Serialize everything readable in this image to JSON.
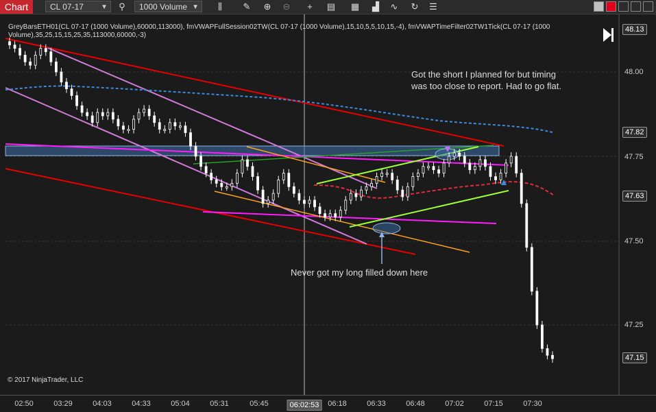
{
  "toolbar": {
    "chart_tab": "Chart",
    "instrument": "CL 07-17",
    "period": "1000 Volume",
    "icons": [
      "search-icon",
      "bar-type-icon",
      "pencil-icon",
      "zoom-in-icon",
      "zoom-out-icon",
      "crosshair-icon",
      "data-box-icon",
      "chart-style-icon",
      "strategy-icon",
      "indicators-icon",
      "drawing-tools-icon",
      "reload-icon",
      "properties-icon"
    ],
    "window_colors": {
      "minimize": "#bfbfbf",
      "close": "#e0001b"
    }
  },
  "indicator_label": "GreyBarsETH01(CL 07-17 (1000 Volume),60000,113000), fmVWAPFullSession02TW(CL 07-17 (1000 Volume),15,10,5,5,10,15,-4), fmVWAPTimeFilter02TW1Tick(CL 07-17 (1000 Volume),35,25,15,15,25,35,113000,60000,-3)",
  "annotations": {
    "top_note_line1": "Got the short I planned for but timing",
    "top_note_line2": "was too close to report. Had to go flat.",
    "bottom_note": "Never got my long filled down here"
  },
  "copyright": "© 2017 NinjaTrader, LLC",
  "x_axis": {
    "ticks": [
      "02:50",
      "03:29",
      "04:03",
      "04:33",
      "05:04",
      "05:31",
      "05:45",
      "06:02:53",
      "06:18",
      "06:33",
      "06:48",
      "07:02",
      "07:15",
      "07:30"
    ],
    "highlight": "06:02:53"
  },
  "y_axis": {
    "ticks": [
      "48.00",
      "47.75",
      "47.50",
      "47.25"
    ],
    "tags": [
      "48.13",
      "47.82",
      "47.63",
      "47.15"
    ]
  },
  "chart_data": {
    "type": "candlestick",
    "instrument": "CL 07-17",
    "ylim": [
      47.08,
      48.17
    ],
    "price_tags": {
      "last": 47.15,
      "vwap_upper": 47.82,
      "vwap_mid": 47.63,
      "top": 48.13
    },
    "close_path": [
      48.08,
      48.07,
      48.05,
      48.03,
      48.02,
      48.05,
      48.07,
      48.06,
      48.03,
      48.0,
      47.97,
      47.95,
      47.93,
      47.9,
      47.88,
      47.87,
      47.85,
      47.88,
      47.87,
      47.88,
      47.86,
      47.84,
      47.83,
      47.83,
      47.86,
      47.88,
      47.89,
      47.87,
      47.85,
      47.83,
      47.83,
      47.85,
      47.84,
      47.84,
      47.82,
      47.78,
      47.75,
      47.72,
      47.7,
      47.68,
      47.67,
      47.66,
      47.66,
      47.67,
      47.7,
      47.74,
      47.72,
      47.69,
      47.65,
      47.61,
      47.62,
      47.64,
      47.68,
      47.7,
      47.66,
      47.64,
      47.62,
      47.61,
      47.62,
      47.6,
      47.58,
      47.57,
      47.58,
      47.57,
      47.59,
      47.62,
      47.64,
      47.63,
      47.65,
      47.66,
      47.67,
      47.69,
      47.7,
      47.7,
      47.68,
      47.65,
      47.63,
      47.66,
      47.69,
      47.7,
      47.72,
      47.72,
      47.71,
      47.7,
      47.73,
      47.75,
      47.76,
      47.75,
      47.73,
      47.71,
      47.72,
      47.74,
      47.72,
      47.69,
      47.68,
      47.7,
      47.73,
      47.75,
      47.7,
      47.61,
      47.48,
      47.35,
      47.25,
      47.18,
      47.16,
      47.15
    ]
  },
  "colors": {
    "background": "#1b1b1b",
    "candle": "#ffffff",
    "vwap_blue": "#3c8de0",
    "vwap_red": "#e52b3c",
    "red_line": "#e80000",
    "magenta_line": "#ff1cff",
    "violet_line": "#d07bd8",
    "orange_line": "#ffa31a",
    "lime_line": "#9bff3c",
    "green_line": "#2aa02a",
    "zone": "#3c6ea8"
  }
}
